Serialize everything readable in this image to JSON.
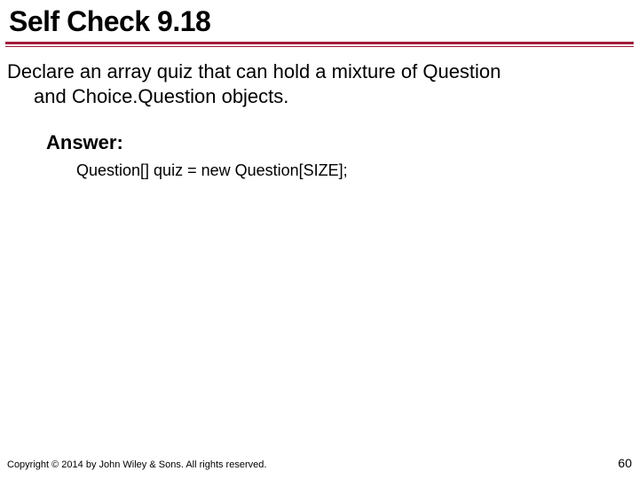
{
  "title": "Self Check 9.18",
  "prompt_line1": "Declare an array quiz that can hold a mixture of Question",
  "prompt_line2": "and Choice.Question objects.",
  "answer_label": "Answer:",
  "code": "Question[] quiz = new Question[SIZE];",
  "copyright": "Copyright © 2014 by John Wiley & Sons. All rights reserved.",
  "page_number": "60"
}
